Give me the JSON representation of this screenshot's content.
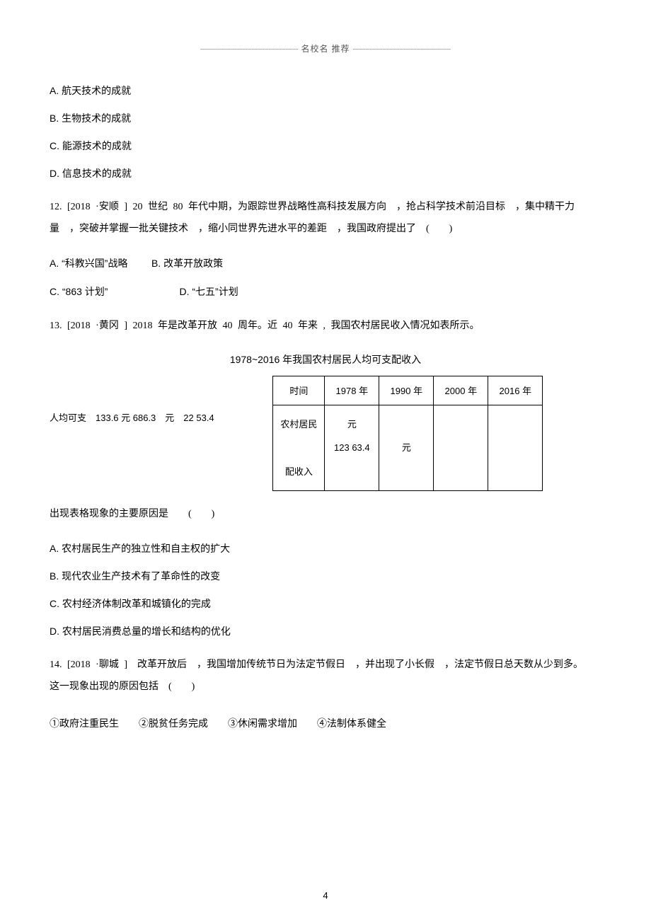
{
  "header": {
    "label": "名校名 推荐"
  },
  "q11_options": {
    "a": "A. 航天技术的成就",
    "b": "B. 生物技术的成就",
    "c": "C. 能源技术的成就",
    "d": "D. 信息技术的成就"
  },
  "q12": {
    "stem": "12. [2018 ·安顺 ] 20 世纪 80 年代中期，为跟踪世界战略性高科技发展方向 ，抢占科学技术前沿目标 ，集中精干力量 ，突破并掌握一批关键技术 ，缩小同世界先进水平的差距 ，我国政府提出了 (  )",
    "opt_a": "A. “科教兴国”战略",
    "opt_b": "B. 改革开放政策",
    "opt_c": "C. “863 计划”",
    "opt_d": "D. “七五”计划"
  },
  "q13": {
    "stem": "13. [2018 ·黄冈 ] 2018 年是改革开放 40 周年。近 40 年来 , 我国农村居民收入情况如表所示。",
    "table_title": "1978~2016 年我国农村居民人均可支配收入",
    "col_time": "时间",
    "col_1978": "1978 年",
    "col_1990": "1990 年",
    "col_2000": "2000 年",
    "col_2016": "2016 年",
    "row_label_l1": "农村居民",
    "row_label_l2": "",
    "row_label_l3": "配收入",
    "outside_left": "人均可支 133.6 元 686.3 元 22 53.4",
    "cell_1978_top": "元",
    "cell_1978_mid": "123 63.4",
    "cell_1990": "元",
    "ask": "出现表格现象的主要原因是  (  )",
    "opt_a": "A. 农村居民生产的独立性和自主权的扩大",
    "opt_b": "B. 现代农业生产技术有了革命性的改变",
    "opt_c": "C. 农村经济体制改革和城镇化的完成",
    "opt_d": "D. 农村居民消费总量的增长和结构的优化"
  },
  "q14": {
    "stem": "14. [2018 ·聊城 ] 改革开放后 ，我国增加传统节日为法定节假日 ，并出现了小长假 ，法定节假日总天数从少到多。 这一现象出现的原因包括 (  )",
    "choices": "①政府注重民生  ②脱贫任务完成  ③休闲需求增加  ④法制体系健全"
  },
  "page_num": "4",
  "chart_data": {
    "type": "table",
    "title": "1978~2016 年我国农村居民人均可支配收入",
    "columns": [
      "时间",
      "1978 年",
      "1990 年",
      "2000 年",
      "2016 年"
    ],
    "row_label": "农村居民人均可支配收入",
    "values_text": [
      "133.6 元",
      "686.3 元",
      "2253.4 元",
      "12363.4 元"
    ],
    "values_numeric": [
      133.6,
      686.3,
      2253.4,
      12363.4
    ],
    "unit": "元"
  }
}
